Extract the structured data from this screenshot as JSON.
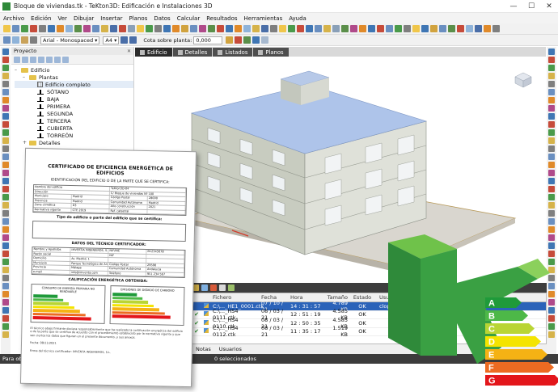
{
  "window": {
    "title": "Bloque de viviendas.tk - TeKton3D: Edificación e Instalaciones 3D"
  },
  "menu": [
    "Archivo",
    "Edición",
    "Ver",
    "Dibujar",
    "Insertar",
    "Planos",
    "Datos",
    "Calcular",
    "Resultados",
    "Herramientas",
    "Ayuda"
  ],
  "toolbar": {
    "font_name": "Arial - Monospaced",
    "font_size": "A4",
    "plant_label": "Cota sobre planta:",
    "plant_value": "0,000"
  },
  "project_panel": {
    "title": "Proyecto",
    "tree": [
      {
        "label": "Edificio",
        "level": 0,
        "icon": "folder-icon",
        "toggle": "–"
      },
      {
        "label": "Plantas",
        "level": 1,
        "icon": "folder-icon",
        "toggle": "–"
      },
      {
        "label": "Edificio completo",
        "level": 2,
        "icon": "grid-icon",
        "toggle": ""
      },
      {
        "label": "SÓTANO",
        "level": 2,
        "icon": "level-icon",
        "toggle": ""
      },
      {
        "label": "BAJA",
        "level": 2,
        "icon": "level-icon",
        "toggle": ""
      },
      {
        "label": "PRIMERA",
        "level": 2,
        "icon": "level-icon",
        "toggle": ""
      },
      {
        "label": "SEGUNDA",
        "level": 2,
        "icon": "level-icon",
        "toggle": ""
      },
      {
        "label": "TERCERA",
        "level": 2,
        "icon": "level-icon",
        "toggle": ""
      },
      {
        "label": "CUBIERTA",
        "level": 2,
        "icon": "level-icon",
        "toggle": ""
      },
      {
        "label": "TORREÓN",
        "level": 2,
        "icon": "level-icon",
        "toggle": ""
      },
      {
        "label": "Detalles",
        "level": 1,
        "icon": "folder-icon",
        "toggle": "+"
      }
    ]
  },
  "view_tabs": [
    "Edificio",
    "Detalles",
    "Listados",
    "Planos"
  ],
  "file_grid": {
    "columns": [
      "",
      "",
      "Fichero",
      "Fecha",
      "Hora",
      "Tamaño",
      "Estado",
      "Usuario"
    ],
    "rows": [
      {
        "check": "",
        "file": "C:\\..._HE1_0001.ctk",
        "date": "07 / 10 / 21",
        "time": "14 : 31 : 57",
        "size": "4.789 KB",
        "status": "OK",
        "user": "clopez",
        "selected": true
      },
      {
        "check": "✔",
        "file": "C:\\..._HS4 0111.ctk",
        "date": "08 / 03 / 21",
        "time": "12 : 51 : 19",
        "size": "4.585 KB",
        "status": "OK",
        "user": "",
        "selected": false
      },
      {
        "check": "✔",
        "file": "C:\\..._HS4 0110.ctk",
        "date": "08 / 03 / 21",
        "time": "12 : 50 : 35",
        "size": "4.585 KB",
        "status": "OK",
        "user": "",
        "selected": false
      },
      {
        "check": "✔",
        "file": "C:\\..._HS4 0112.ctk",
        "date": "08 / 03 / 21",
        "time": "11 : 35 : 17",
        "size": "1.519 KB",
        "status": "OK",
        "user": "",
        "selected": false
      }
    ]
  },
  "bottom_tabs": [
    "Notas",
    "Usuarios"
  ],
  "status": {
    "left": "Para obten",
    "right": "0 seleccionados"
  },
  "certificate": {
    "title": "CERTIFICADO DE EFICIENCIA ENERGÉTICA DE EDIFICIOS",
    "subtitle": "IDENTIFICACIÓN DEL EDIFICIO O DE LA PARTE QUE SE CERTIFICA:",
    "rows1": [
      [
        "Nombre del edificio",
        "TeKton3D-04"
      ],
      [
        "Dirección",
        "C/ Bloque de viviendas Nº 100"
      ],
      [
        "Municipio",
        "Madrid",
        "Código Postal",
        "28000"
      ],
      [
        "Provincia",
        "Madrid",
        "Comunidad Autónoma",
        "Madrid"
      ],
      [
        "Zona climática",
        "D3",
        "Año construcción",
        "2021"
      ],
      [
        "Normativa vigente",
        "CTE 2019",
        "Ref. catastral",
        ""
      ]
    ],
    "section2": "Tipo de edificio o parte del edificio que se certifica:",
    "section3": "DATOS DEL TÉCNICO CERTIFICADOR:",
    "rows3": [
      [
        "Nombre y Apellidos",
        "IMVERTIA INGENIEROS, S.L.",
        "NIF/NIE",
        "B12345678"
      ],
      [
        "Razón social",
        "",
        "NIF",
        ""
      ],
      [
        "Domicilio",
        "Av. Madrid, 1",
        "",
        ""
      ],
      [
        "Municipio",
        "Parque Tecnológico de Andalucía",
        "Código Postal",
        "29590"
      ],
      [
        "Provincia",
        "Málaga",
        "Comunidad Autónoma",
        "Andalucía"
      ],
      [
        "e-mail",
        "info@imventa.com",
        "Teléfono",
        "951 234 567"
      ]
    ],
    "section4": "CALIFICACIÓN ENERGÉTICA OBTENIDA:",
    "rating1_head": "CONSUMO DE ENERGÍA PRIMARIA NO RENOVABLE",
    "rating2_head": "EMISIONES DE DIÓXIDO DE CARBONO",
    "footer": "El técnico abajo firmante declara responsablemente que ha realizado la certificación energética del edificio o de la parte que se certifica de acuerdo con el procedimiento establecido por la normativa vigente y que son ciertos los datos que figuran en el presente documento, y sus anexos.",
    "date_line": "Fecha: 08/11/2021",
    "sign_line": "Firma del técnico certificador: IMVENTA INGENIEROS, S.L."
  },
  "energy_labels": [
    "A",
    "B",
    "C",
    "D",
    "E",
    "F",
    "G"
  ],
  "colors": {
    "brand_green": "#2f8a3a",
    "rating_A": "#1f9a3a",
    "rating_B": "#4db848",
    "rating_C": "#b9d534",
    "rating_D": "#f4e400",
    "rating_E": "#f5b214",
    "rating_F": "#ec6b22",
    "rating_G": "#e3161b",
    "selection": "#2b63b9"
  }
}
